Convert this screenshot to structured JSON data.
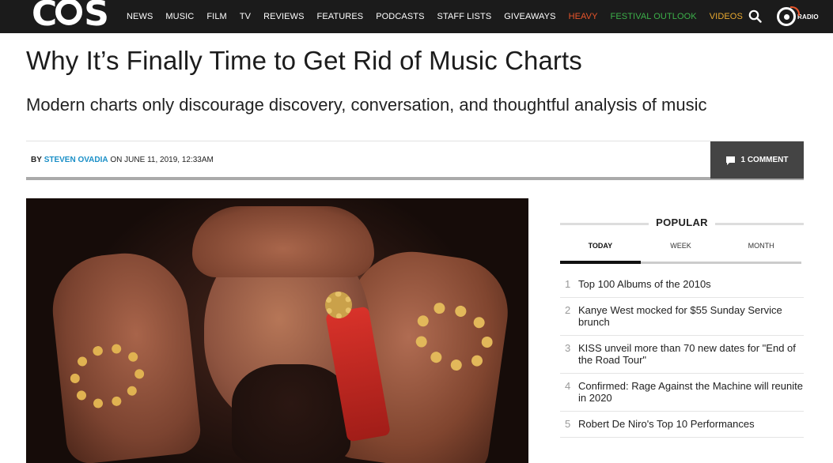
{
  "nav": {
    "logo": "COS",
    "links": [
      "NEWS",
      "MUSIC",
      "FILM",
      "TV",
      "REVIEWS",
      "FEATURES",
      "PODCASTS",
      "STAFF LISTS",
      "GIVEAWAYS"
    ],
    "heavy": "HEAVY",
    "festival": "FESTIVAL OUTLOOK",
    "videos": "VIDEOS",
    "radio": "RADIO",
    "search_icon": "search-icon",
    "colors": {
      "bar": "#1b1b1b",
      "heavy": "#e8552b",
      "festival": "#3cb04a",
      "videos": "#e8a930"
    }
  },
  "article": {
    "title": "Why It’s Finally Time to Get Rid of Music Charts",
    "subtitle": "Modern charts only discourage discovery, conversation, and thoughtful analysis of music",
    "byline_prefix": "BY",
    "author": "STEVEN OVADIA",
    "date": "ON JUNE 11, 2019, 12:33AM",
    "comments": "1 COMMENT",
    "author_color": "#1a8fc7"
  },
  "popular": {
    "title": "POPULAR",
    "tabs": [
      "TODAY",
      "WEEK",
      "MONTH"
    ],
    "active_tab": "TODAY",
    "items": [
      {
        "num": "1",
        "text": "Top 100 Albums of the 2010s"
      },
      {
        "num": "2",
        "text": "Kanye West mocked for $55 Sunday Service brunch"
      },
      {
        "num": "3",
        "text": "KISS unveil more than 70 new dates for \"End of the Road Tour\""
      },
      {
        "num": "4",
        "text": "Confirmed: Rage Against the Machine will reunite in 2020"
      },
      {
        "num": "5",
        "text": "Robert De Niro's Top 10 Performances"
      }
    ]
  }
}
